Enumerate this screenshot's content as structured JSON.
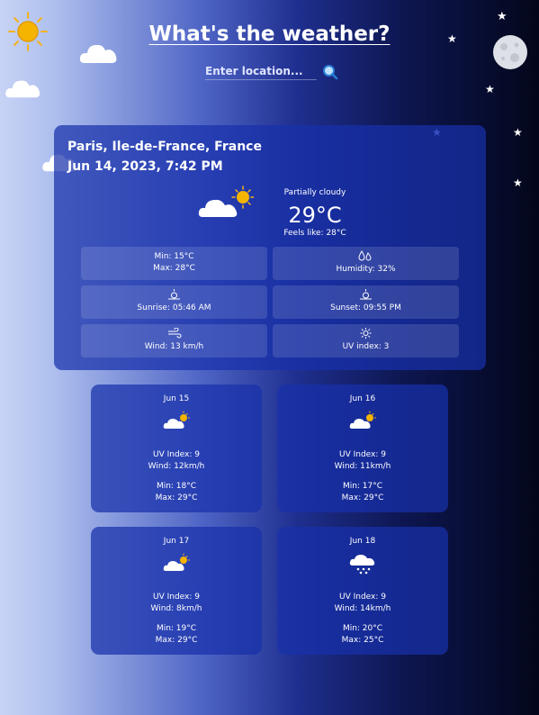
{
  "title": "What's the weather?",
  "search": {
    "placeholder": "Enter location..."
  },
  "current": {
    "location": "Paris, Ile-de-France, France",
    "datetime": "Jun 14, 2023, 7:42 PM",
    "condition": "Partially cloudy",
    "temperature": "29°C",
    "feels_like": "Feels like: 28°C",
    "min": "Min: 15°C",
    "max": "Max: 28°C",
    "humidity": "Humidity: 32%",
    "sunrise": "Sunrise: 05:46 AM",
    "sunset": "Sunset: 09:55 PM",
    "wind": "Wind: 13 km/h",
    "uv": "UV index: 3"
  },
  "forecast": [
    {
      "date": "Jun 15",
      "icon": "partly-cloudy-icon",
      "uv": "UV Index: 9",
      "wind": "Wind: 12km/h",
      "min": "Min: 18°C",
      "max": "Max: 29°C"
    },
    {
      "date": "Jun 16",
      "icon": "partly-cloudy-icon",
      "uv": "UV Index: 9",
      "wind": "Wind: 11km/h",
      "min": "Min: 17°C",
      "max": "Max: 29°C"
    },
    {
      "date": "Jun 17",
      "icon": "partly-cloudy-icon",
      "uv": "UV Index: 9",
      "wind": "Wind: 8km/h",
      "min": "Min: 19°C",
      "max": "Max: 29°C"
    },
    {
      "date": "Jun 18",
      "icon": "rain-icon",
      "uv": "UV Index: 9",
      "wind": "Wind: 14km/h",
      "min": "Min: 20°C",
      "max": "Max: 25°C"
    }
  ],
  "colors": {
    "card": "#1830aa",
    "sun": "#f5b400",
    "accent": "#ffffff"
  }
}
